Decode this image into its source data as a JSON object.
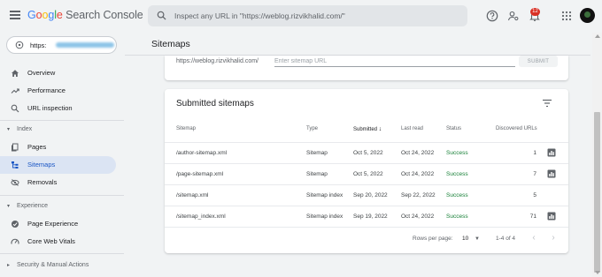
{
  "header": {
    "logo_text": "Google Search Console",
    "search_placeholder": "Inspect any URL in \"https://weblog.rizvikhalid.com/\"",
    "notification_count": "12",
    "icons": [
      "menu-icon",
      "help-icon",
      "manage-users-icon",
      "notifications-icon",
      "apps-icon",
      "avatar"
    ]
  },
  "sidebar": {
    "property": "https://weblog.rizvikhalid.com/",
    "property_visible": "https:",
    "items": [
      {
        "label": "Overview",
        "icon": "home-icon"
      },
      {
        "label": "Performance",
        "icon": "trending-up-icon"
      },
      {
        "label": "URL inspection",
        "icon": "search-icon"
      }
    ],
    "index_section": "Index",
    "index_items": [
      {
        "label": "Pages",
        "icon": "pages-icon"
      },
      {
        "label": "Sitemaps",
        "icon": "sitemap-icon",
        "active": true
      },
      {
        "label": "Removals",
        "icon": "removals-icon"
      }
    ],
    "experience_section": "Experience",
    "experience_items": [
      {
        "label": "Page Experience",
        "icon": "page-experience-icon"
      },
      {
        "label": "Core Web Vitals",
        "icon": "speed-icon"
      }
    ],
    "security_section": "Security & Manual Actions"
  },
  "main": {
    "title": "Sitemaps",
    "add_sitemap": {
      "url_prefix": "https://weblog.rizvikhalid.com/",
      "placeholder": "Enter sitemap URL",
      "submit_label": "SUBMIT"
    },
    "submitted": {
      "title": "Submitted sitemaps",
      "columns": [
        "Sitemap",
        "Type",
        "Submitted",
        "Last read",
        "Status",
        "Discovered URLs"
      ],
      "rows": [
        {
          "sitemap": "/author-sitemap.xml",
          "type": "Sitemap",
          "submitted": "Oct 5, 2022",
          "last_read": "Oct 24, 2022",
          "status": "Success",
          "discovered": "1",
          "has_chart": true
        },
        {
          "sitemap": "/page-sitemap.xml",
          "type": "Sitemap",
          "submitted": "Oct 5, 2022",
          "last_read": "Oct 24, 2022",
          "status": "Success",
          "discovered": "7",
          "has_chart": true
        },
        {
          "sitemap": "/sitemap.xml",
          "type": "Sitemap index",
          "submitted": "Sep 20, 2022",
          "last_read": "Sep 22, 2022",
          "status": "Success",
          "discovered": "5",
          "has_chart": false
        },
        {
          "sitemap": "/sitemap_index.xml",
          "type": "Sitemap index",
          "submitted": "Sep 19, 2022",
          "last_read": "Oct 24, 2022",
          "status": "Success",
          "discovered": "71",
          "has_chart": true
        }
      ],
      "pagination": {
        "rows_per_page_label": "Rows per page:",
        "rows_per_page": "10",
        "range": "1-4 of 4"
      }
    }
  },
  "colors": {
    "accent": "#1a56c4",
    "active_bg": "#dbe4f3",
    "success": "#188038",
    "badge": "#d93025"
  }
}
